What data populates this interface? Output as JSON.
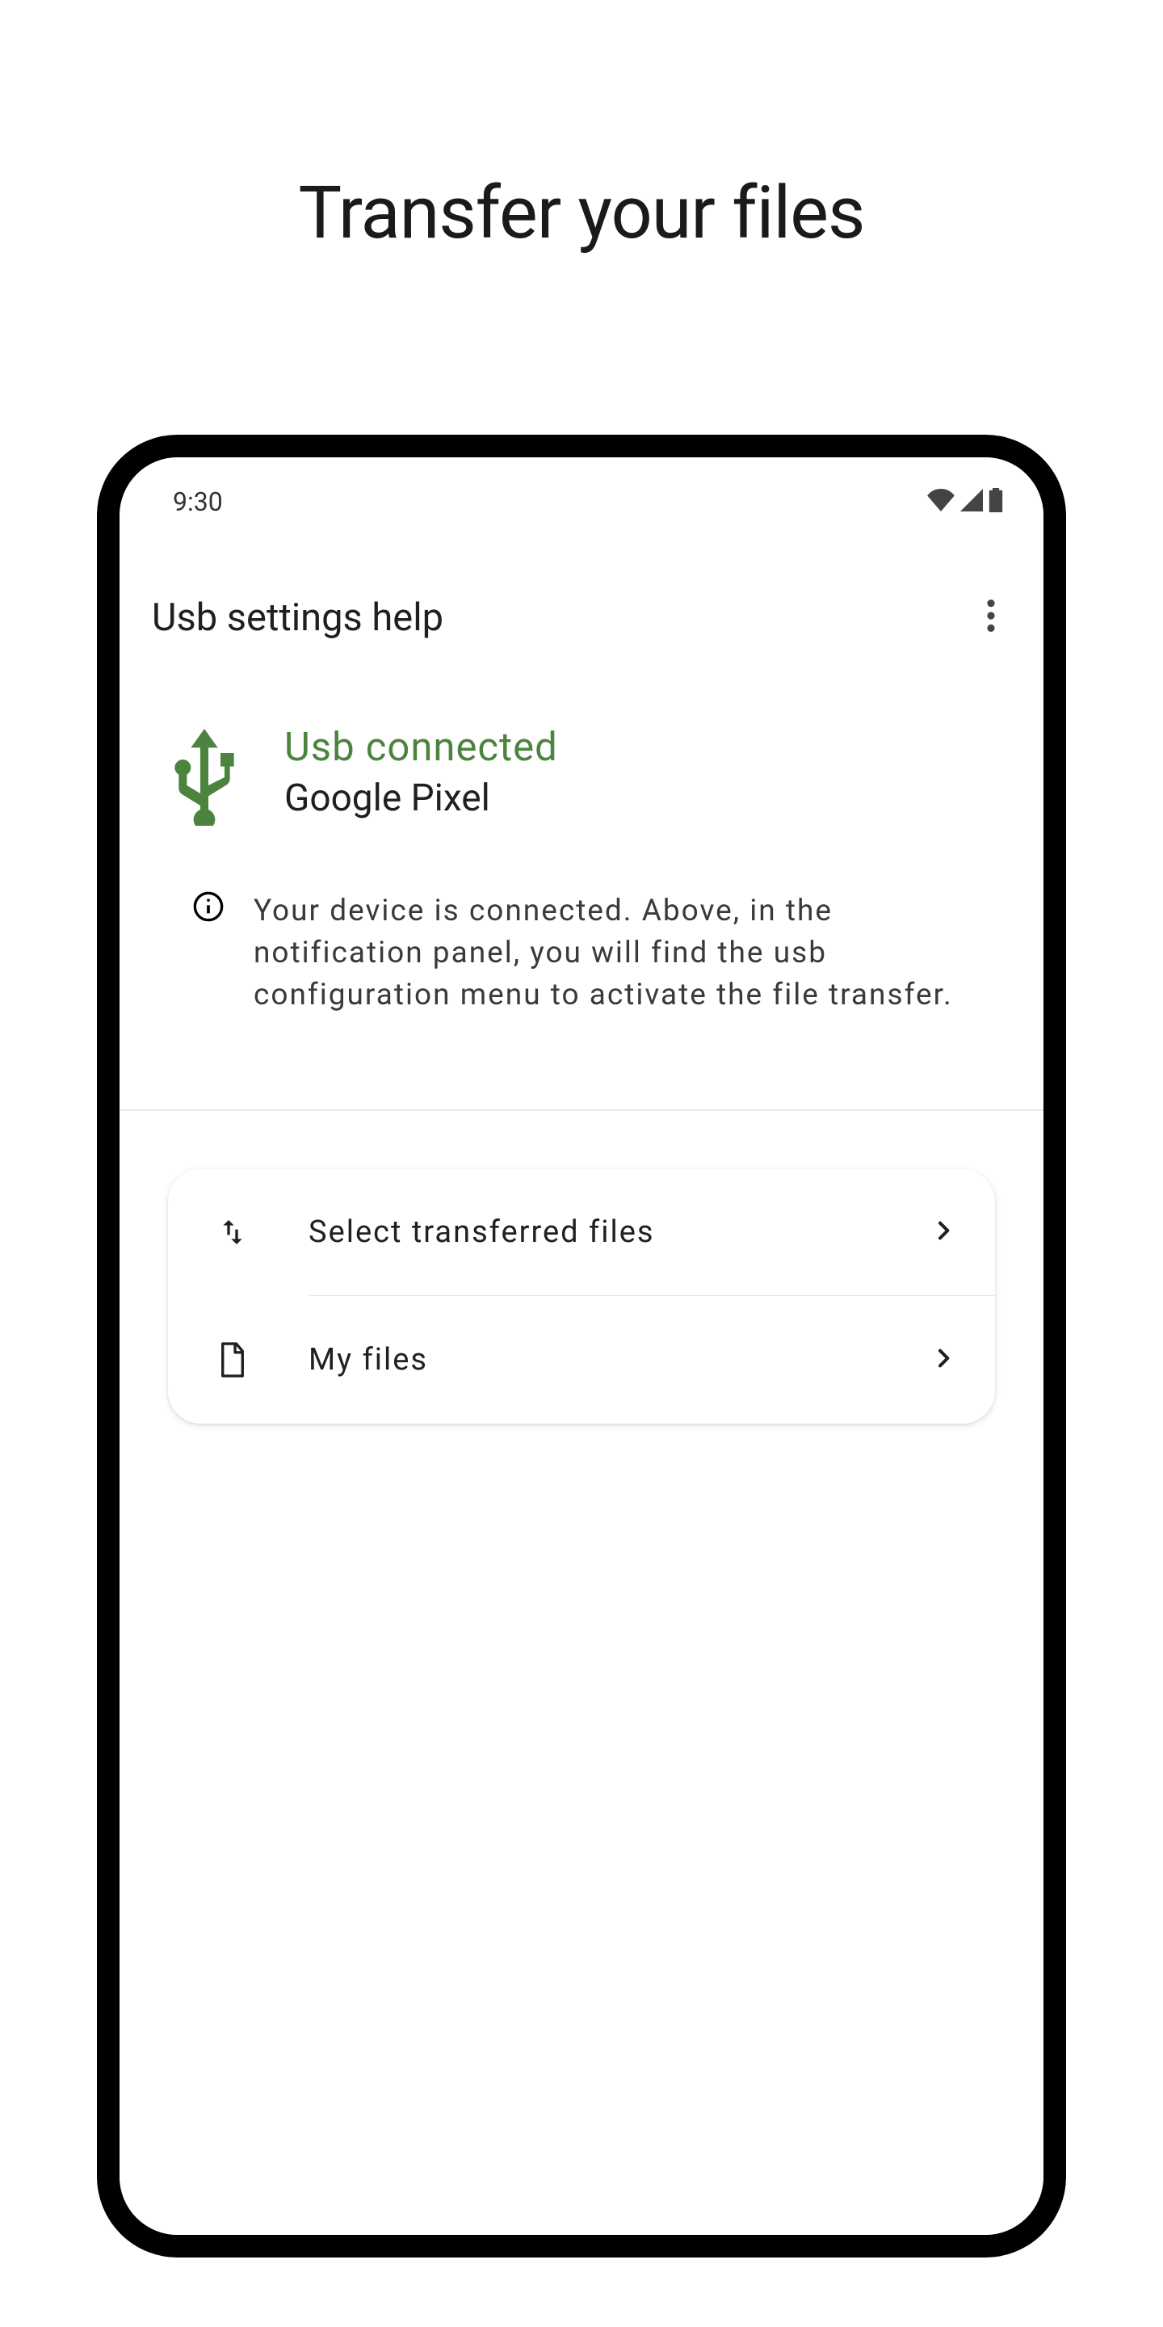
{
  "page": {
    "title": "Transfer your files"
  },
  "status_bar": {
    "time": "9:30"
  },
  "app_bar": {
    "title": "Usb settings help"
  },
  "connection": {
    "status": "Usb connected",
    "device": "Google Pixel",
    "info": "Your device is connected. Above, in the notification panel, you will find the usb configuration menu to activate the file transfer."
  },
  "actions": [
    {
      "label": "Select transferred files",
      "icon": "swap-vert-icon"
    },
    {
      "label": "My files",
      "icon": "file-icon"
    }
  ],
  "colors": {
    "accent_green": "#4c833f",
    "status_icon": "#444444"
  }
}
